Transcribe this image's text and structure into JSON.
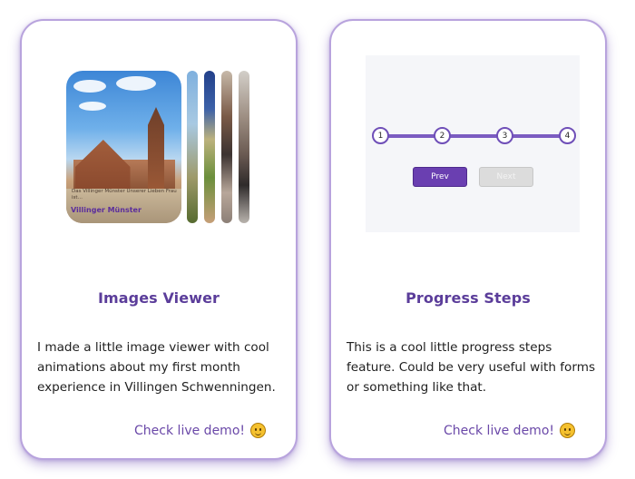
{
  "cards": [
    {
      "title": "Images Viewer",
      "description": "I made a little image viewer with cool animations about my first month experience in Villingen Schwenningen.",
      "link_label": "Check live demo!",
      "preview": {
        "caption_small": "Das Villinger Münster Unserer Lieben Frau ist…",
        "caption_title": "Villinger Münster"
      }
    },
    {
      "title": "Progress Steps",
      "description": "This is a cool little progress steps feature. Could be very useful with forms or something like that.",
      "link_label": "Check live demo!",
      "preview": {
        "steps": [
          "1",
          "2",
          "3",
          "4"
        ],
        "prev_label": "Prev",
        "next_label": "Next"
      }
    }
  ],
  "colors": {
    "accent": "#5b3d9a",
    "border": "#b8a3dd",
    "link": "#6a48a8"
  },
  "icons": {
    "link_emoji": "smiley-icon"
  }
}
